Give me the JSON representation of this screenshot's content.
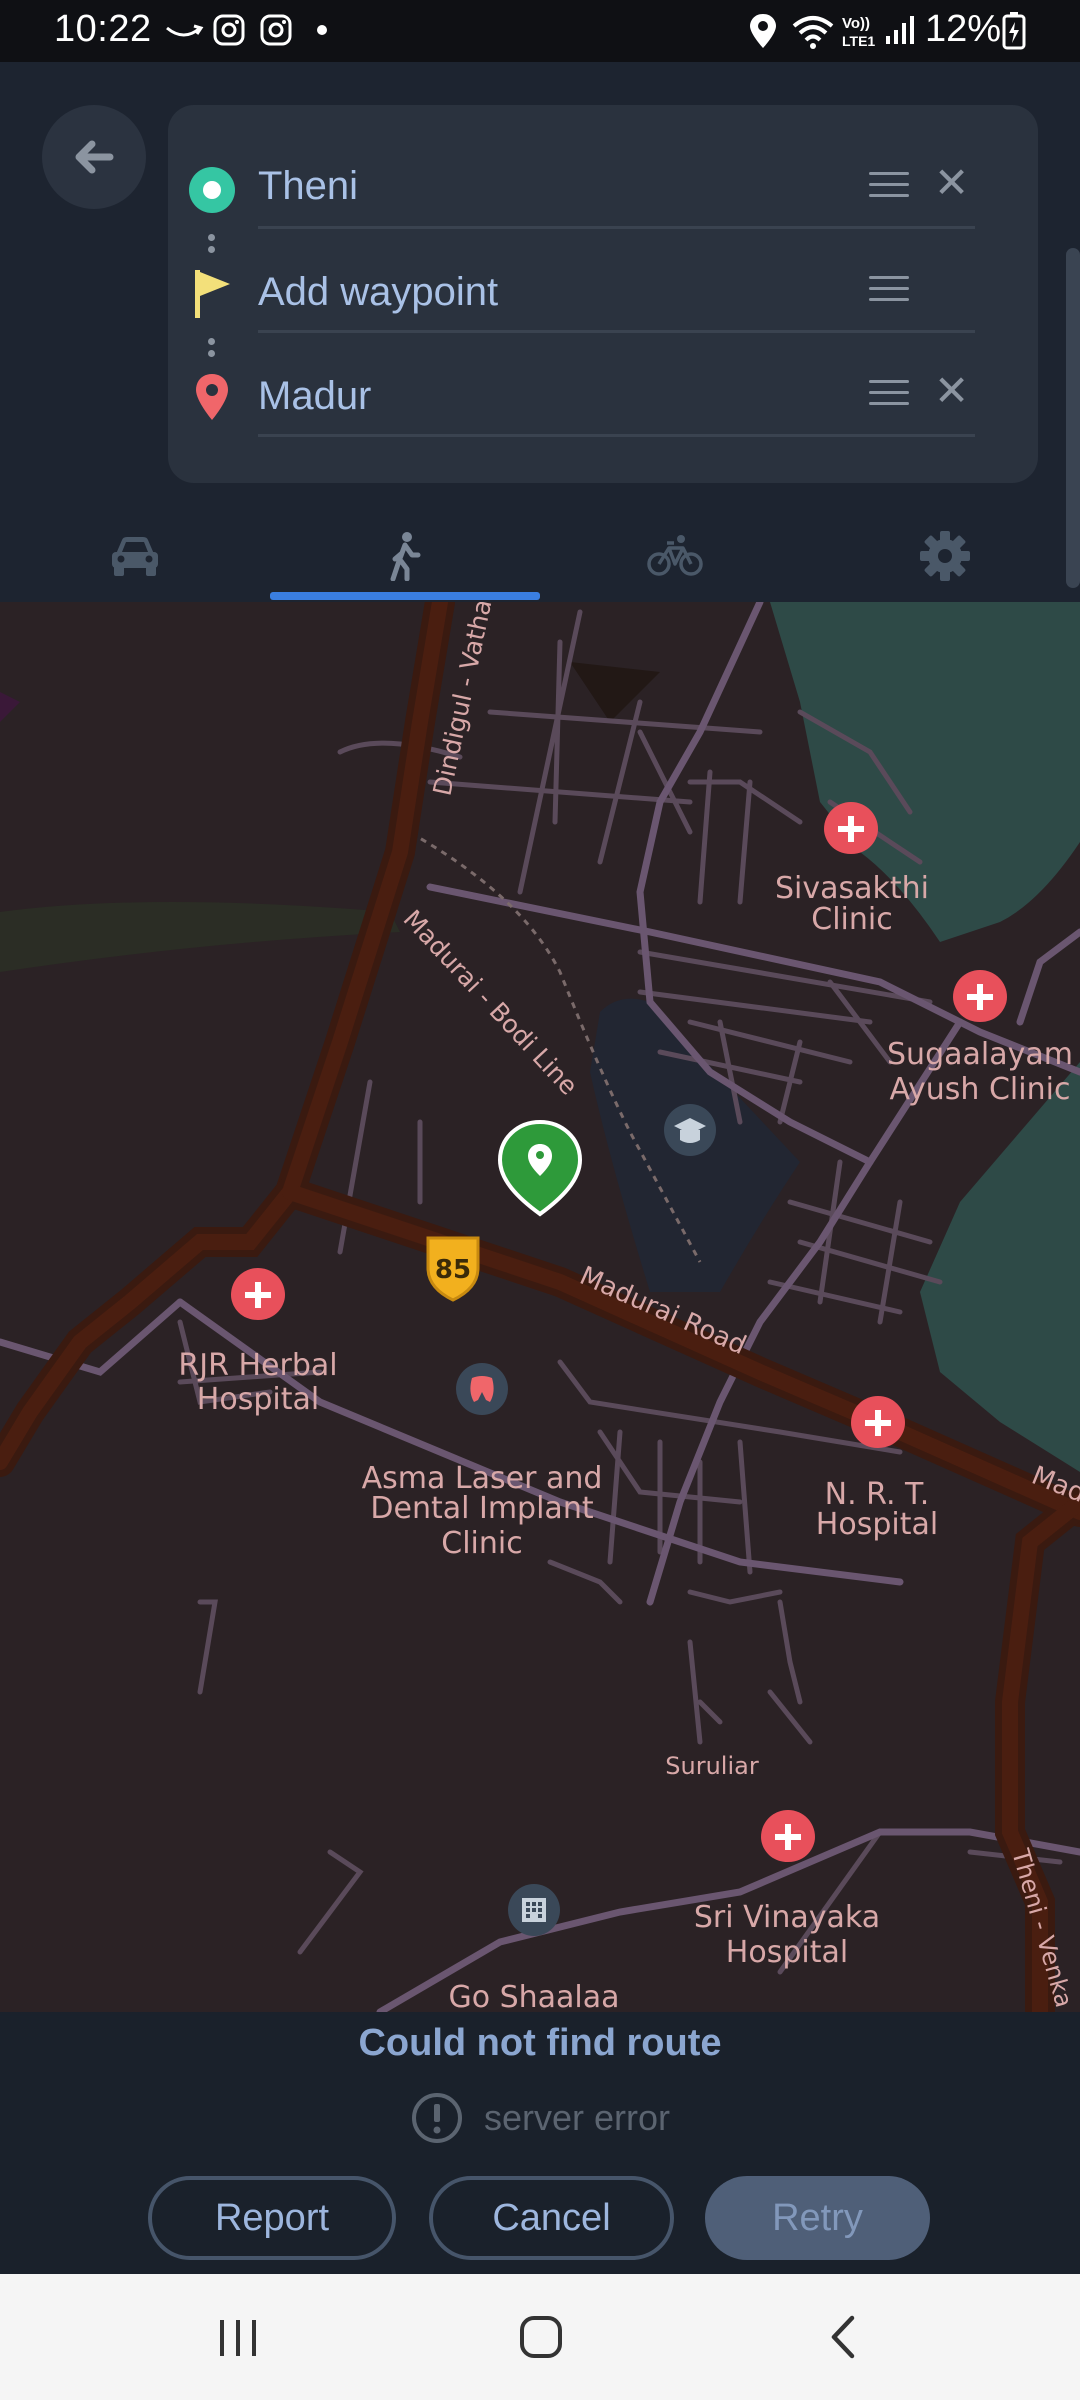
{
  "status_bar": {
    "time": "10:22",
    "battery": "12%",
    "left_icons": [
      "amazon-smile-icon",
      "instagram-icon",
      "instagram-icon",
      "dot-icon"
    ],
    "right_icons": [
      "location-icon",
      "wifi-icon",
      "volte-icon",
      "signal-icon",
      "battery-charging-icon"
    ]
  },
  "route_editor": {
    "waypoints": [
      {
        "label": "Theni",
        "icon": "origin-dot-icon",
        "removable": true
      },
      {
        "label": "Add waypoint",
        "icon": "flag-icon",
        "removable": false
      },
      {
        "label": "Madur",
        "icon": "destination-pin-icon",
        "removable": true
      }
    ]
  },
  "modes": {
    "items": [
      {
        "name": "car",
        "icon": "car-icon"
      },
      {
        "name": "walk",
        "icon": "walk-icon",
        "selected": true
      },
      {
        "name": "bike",
        "icon": "bicycle-icon"
      },
      {
        "name": "settings",
        "icon": "gear-icon"
      }
    ]
  },
  "map": {
    "road_labels": {
      "dindigul": "Dindigul - Vatha",
      "bodi_line": "Madurai - Bodi Line",
      "madurai_road": "Madurai Road",
      "madu_edge": "Madu",
      "theni_venka": "Theni - Venka"
    },
    "place_labels": {
      "sivasakthi_1": "Sivasakthi",
      "sivasakthi_2": "Clinic",
      "sugaalayam_1": "Sugaalayam",
      "sugaalayam_2": "Ayush Clinic",
      "rjr_1": "RJR Herbal",
      "rjr_2": "Hospital",
      "asma_1": "Asma Laser and",
      "asma_2": "Dental Implant",
      "asma_3": "Clinic",
      "nrt_1": "N. R. T.",
      "nrt_2": "Hospital",
      "suruliar": "Suruliar",
      "vinayaka_1": "Sri Vinayaka",
      "vinayaka_2": "Hospital",
      "go_shaalaa": "Go Shaalaa",
      "theni_partial": "T     i"
    },
    "highway_shield": "85",
    "colors": {
      "background": "#2b2225",
      "water": "#2e4a47",
      "road_major": "#3a1a10",
      "road_minor": "#5a4a5a",
      "hospital_marker": "#e8505b",
      "location_marker": "#2e9a3a",
      "shield": "#f2b01e"
    }
  },
  "route_status": {
    "title": "Could not find route",
    "error": "server error"
  },
  "actions": {
    "report": "Report",
    "cancel": "Cancel",
    "retry": "Retry"
  },
  "nav_bar": {
    "icons": [
      "recents-icon",
      "home-icon",
      "back-icon"
    ]
  }
}
